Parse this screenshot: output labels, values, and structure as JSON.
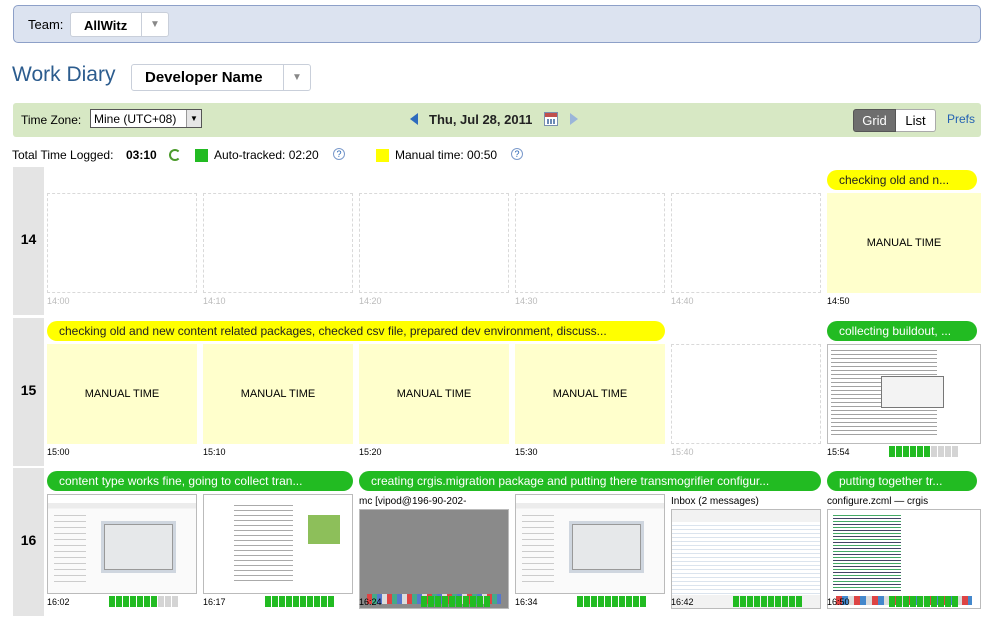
{
  "header": {
    "team_label": "Team:",
    "team_value": "AllWitz"
  },
  "page": {
    "title": "Work Diary",
    "developer": "Developer Name"
  },
  "toolbar": {
    "tz_label": "Time Zone:",
    "tz_value": "Mine (UTC+08)",
    "date": "Thu, Jul 28, 2011",
    "grid_label": "Grid",
    "list_label": "List",
    "prefs_label": "Prefs"
  },
  "stats": {
    "total_label": "Total Time Logged:",
    "total_value": "03:10",
    "auto_label": "Auto-tracked: 02:20",
    "manual_label": "Manual time: 00:50"
  },
  "colors": {
    "auto": "#22bb22",
    "manual": "#ffff00",
    "manual_bg": "#ffffcc",
    "accent": "#2c5c8e"
  },
  "hours": [
    {
      "label": "14",
      "memos": [
        {
          "text": "checking old and n...",
          "color": "yellow"
        }
      ],
      "cells": [
        {
          "kind": "empty",
          "time": "14:00"
        },
        {
          "kind": "empty",
          "time": "14:10"
        },
        {
          "kind": "empty",
          "time": "14:20"
        },
        {
          "kind": "empty",
          "time": "14:30"
        },
        {
          "kind": "empty",
          "time": "14:40"
        },
        {
          "kind": "manual",
          "text": "MANUAL TIME",
          "time": "14:50"
        }
      ]
    },
    {
      "label": "15",
      "memos": [
        {
          "text": "checking old and new content related packages, checked csv file, prepared dev environment, discuss...",
          "color": "yellow"
        },
        {
          "text": "collecting buildout, ...",
          "color": "green"
        }
      ],
      "cells": [
        {
          "kind": "manual",
          "text": "MANUAL TIME",
          "time": "15:00"
        },
        {
          "kind": "manual",
          "text": "MANUAL TIME",
          "time": "15:10"
        },
        {
          "kind": "manual",
          "text": "MANUAL TIME",
          "time": "15:20"
        },
        {
          "kind": "manual",
          "text": "MANUAL TIME",
          "time": "15:30"
        },
        {
          "kind": "empty",
          "time": "15:40"
        },
        {
          "kind": "shot",
          "style": "term",
          "time": "15:54",
          "activity": 6
        }
      ]
    },
    {
      "label": "16",
      "memos": [
        {
          "text": "content type works fine, going to collect tran...",
          "color": "green"
        },
        {
          "text": "creating crgis.migration package and putting there transmogrifier configur...",
          "color": "green"
        },
        {
          "text": "putting together tr...",
          "color": "green"
        }
      ],
      "cells": [
        {
          "kind": "shot",
          "style": "a",
          "time": "16:02",
          "activity": 7
        },
        {
          "kind": "shot",
          "style": "doc",
          "time": "16:17",
          "activity": 10
        },
        {
          "kind": "shot",
          "style": "grey",
          "title": "mc [vipod@196-90-202-",
          "time": "16:24",
          "activity": 10
        },
        {
          "kind": "shot",
          "style": "a",
          "time": "16:34",
          "activity": 10
        },
        {
          "kind": "shot",
          "style": "mail",
          "title": "Inbox (2 messages)",
          "time": "16:42",
          "activity": 10
        },
        {
          "kind": "shot",
          "style": "code",
          "title": "configure.zcml — crgis",
          "time": "16:50",
          "activity": 10
        }
      ]
    }
  ]
}
